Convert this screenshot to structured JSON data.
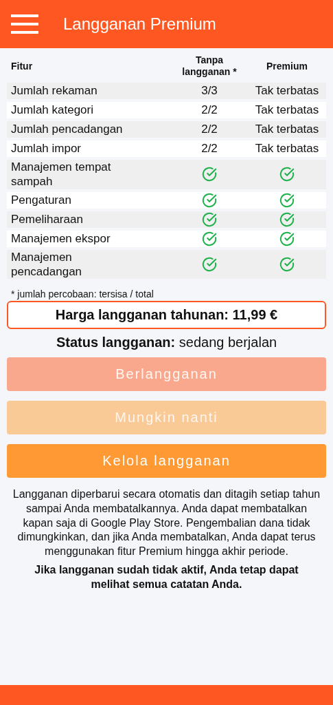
{
  "app_bar": {
    "title": "Langganan Premium"
  },
  "table": {
    "columns": [
      "Fitur",
      "Tanpa langganan *",
      "Premium"
    ],
    "rows": [
      {
        "feature": "Jumlah rekaman",
        "free": {
          "kind": "text",
          "text": "3/3"
        },
        "premium": {
          "kind": "text",
          "text": "Tak terbatas"
        }
      },
      {
        "feature": "Jumlah kategori",
        "free": {
          "kind": "text",
          "text": "2/2"
        },
        "premium": {
          "kind": "text",
          "text": "Tak terbatas"
        }
      },
      {
        "feature": "Jumlah pencadangan",
        "free": {
          "kind": "text",
          "text": "2/2"
        },
        "premium": {
          "kind": "text",
          "text": "Tak terbatas"
        }
      },
      {
        "feature": "Jumlah impor",
        "free": {
          "kind": "text",
          "text": "2/2"
        },
        "premium": {
          "kind": "text",
          "text": "Tak terbatas"
        }
      },
      {
        "feature": "Manajemen tempat sampah",
        "free": {
          "kind": "check"
        },
        "premium": {
          "kind": "check"
        }
      },
      {
        "feature": "Pengaturan",
        "free": {
          "kind": "check"
        },
        "premium": {
          "kind": "check"
        }
      },
      {
        "feature": "Pemeliharaan",
        "free": {
          "kind": "check"
        },
        "premium": {
          "kind": "check"
        }
      },
      {
        "feature": "Manajemen ekspor",
        "free": {
          "kind": "check"
        },
        "premium": {
          "kind": "check"
        }
      },
      {
        "feature": "Manajemen pencadangan",
        "free": {
          "kind": "check"
        },
        "premium": {
          "kind": "check"
        }
      }
    ]
  },
  "footnote": "* jumlah percobaan: tersisa / total",
  "price": "Harga langganan tahunan: 11,99 €",
  "status": "**Status langganan:** sedang berjalan",
  "buttons": [
    {
      "label": "Berlangganan",
      "color": "#f9a78d",
      "disabled": true
    },
    {
      "label": "Mungkin nanti",
      "color": "#f9c996",
      "disabled": true
    },
    {
      "label": "Kelola langganan",
      "color": "#ff9933",
      "disabled": false
    }
  ],
  "notice": "Langganan diperbarui secara otomatis dan ditagih setiap tahun sampai Anda membatalkannya. Anda dapat membatalkan kapan saja di Google Play Store. Pengembalian dana tidak dimungkinkan, dan jika Anda membatalkan, Anda dapat terus menggunakan fitur Premium hingga akhir periode.",
  "notice_bold": "Jika langganan sudah tidak aktif, Anda tetap dapat melihat semua catatan Anda."
}
